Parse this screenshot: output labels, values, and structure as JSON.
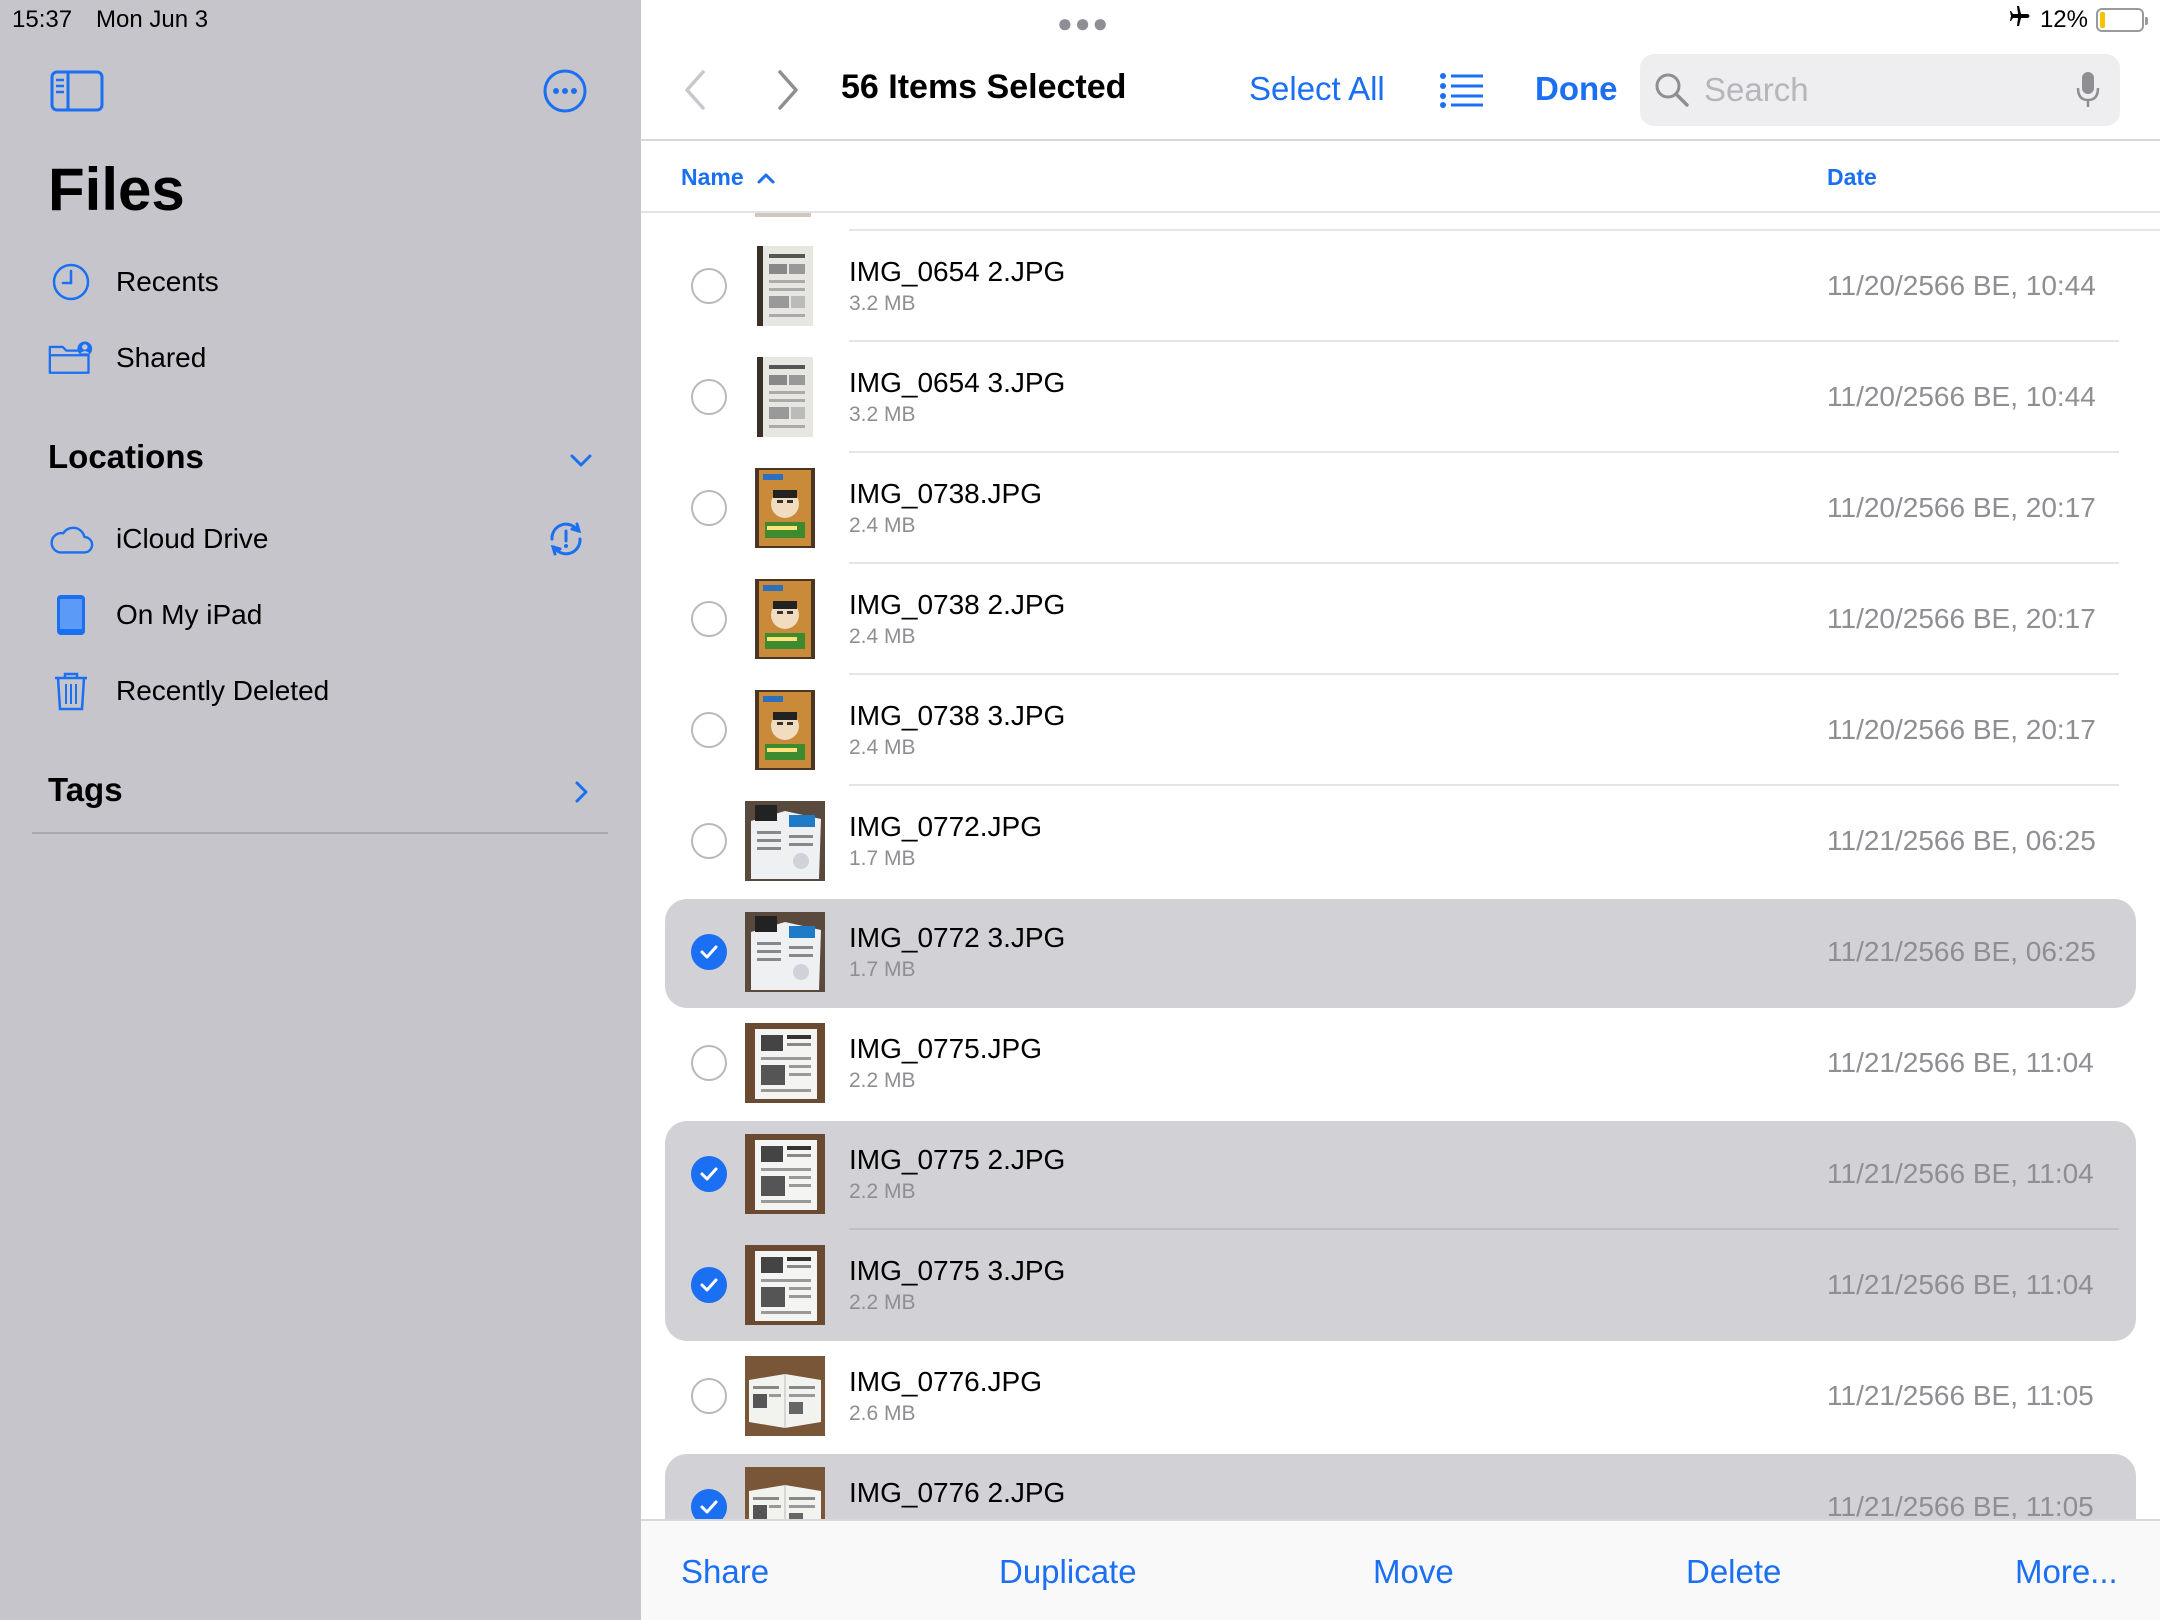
{
  "status": {
    "time": "15:37",
    "date": "Mon Jun 3",
    "battery_text": "12%",
    "battery_level": 0.12,
    "airplane_icon": "airplane-icon"
  },
  "sidebar": {
    "title": "Files",
    "items": [
      {
        "label": "Recents",
        "icon": "clock-icon"
      },
      {
        "label": "Shared",
        "icon": "shared-folder-icon"
      }
    ],
    "locations_label": "Locations",
    "locations": [
      {
        "label": "iCloud Drive",
        "icon": "cloud-icon"
      },
      {
        "label": "On My iPad",
        "icon": "ipad-icon"
      },
      {
        "label": "Recently Deleted",
        "icon": "trash-icon"
      }
    ],
    "tags_label": "Tags"
  },
  "nav": {
    "title": "56 Items Selected",
    "select_all": "Select All",
    "done": "Done",
    "search_placeholder": "Search"
  },
  "columns": {
    "name": "Name",
    "date": "Date"
  },
  "files": [
    {
      "name": "IMG_0654 2.JPG",
      "size": "3.2 MB",
      "date": "11/20/2566 BE, 10:44",
      "selected": false,
      "thumb": "doc"
    },
    {
      "name": "IMG_0654 3.JPG",
      "size": "3.2 MB",
      "date": "11/20/2566 BE, 10:44",
      "selected": false,
      "thumb": "doc"
    },
    {
      "name": "IMG_0738.JPG",
      "size": "2.4 MB",
      "date": "11/20/2566 BE, 20:17",
      "selected": false,
      "thumb": "cover"
    },
    {
      "name": "IMG_0738 2.JPG",
      "size": "2.4 MB",
      "date": "11/20/2566 BE, 20:17",
      "selected": false,
      "thumb": "cover"
    },
    {
      "name": "IMG_0738 3.JPG",
      "size": "2.4 MB",
      "date": "11/20/2566 BE, 20:17",
      "selected": false,
      "thumb": "cover"
    },
    {
      "name": "IMG_0772.JPG",
      "size": "1.7 MB",
      "date": "11/21/2566 BE, 06:25",
      "selected": false,
      "thumb": "brochure"
    },
    {
      "name": "IMG_0772 3.JPG",
      "size": "1.7 MB",
      "date": "11/21/2566 BE, 06:25",
      "selected": true,
      "thumb": "brochure"
    },
    {
      "name": "IMG_0775.JPG",
      "size": "2.2 MB",
      "date": "11/21/2566 BE, 11:04",
      "selected": false,
      "thumb": "page"
    },
    {
      "name": "IMG_0775 2.JPG",
      "size": "2.2 MB",
      "date": "11/21/2566 BE, 11:04",
      "selected": true,
      "thumb": "page"
    },
    {
      "name": "IMG_0775 3.JPG",
      "size": "2.2 MB",
      "date": "11/21/2566 BE, 11:04",
      "selected": true,
      "thumb": "page"
    },
    {
      "name": "IMG_0776.JPG",
      "size": "2.6 MB",
      "date": "11/21/2566 BE, 11:05",
      "selected": false,
      "thumb": "spread"
    },
    {
      "name": "IMG_0776 2.JPG",
      "size": "",
      "date": "11/21/2566 BE, 11:05",
      "selected": true,
      "thumb": "spread"
    }
  ],
  "toolbar": {
    "share": "Share",
    "duplicate": "Duplicate",
    "move": "Move",
    "delete": "Delete",
    "more": "More..."
  },
  "colors": {
    "accent": "#1a6ff2",
    "sidebar_bg": "#c5c5cb",
    "selected_row": "#d1d1d6",
    "secondary_text": "#8e8e93"
  }
}
